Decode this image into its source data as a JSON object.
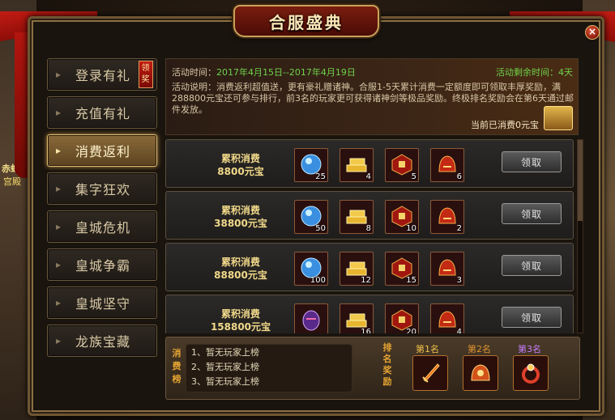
{
  "window": {
    "title": "合服盛典",
    "close_label": "×"
  },
  "background": {
    "left_text_1": "赤蛇",
    "left_text_2": "宫殿"
  },
  "sidebar": {
    "items": [
      {
        "label": "登录有礼",
        "badge": "领奖",
        "active": false
      },
      {
        "label": "充值有礼",
        "active": false
      },
      {
        "label": "消费返利",
        "active": true
      },
      {
        "label": "集字狂欢",
        "active": false
      },
      {
        "label": "皇城危机",
        "active": false
      },
      {
        "label": "皇城争霸",
        "active": false
      },
      {
        "label": "皇城坚守",
        "active": false
      },
      {
        "label": "龙族宝藏",
        "active": false
      }
    ]
  },
  "info": {
    "time_label": "活动时间：",
    "time_value": "2017年4月15日--2017年4月19日",
    "remain_label": "活动剩余时间：",
    "remain_value": "4天",
    "desc": "活动说明：消费返利超值送，更有豪礼赠诸神。合服1-5天累计消费一定额度即可领取丰厚奖励，满288800元宝还可参与排行，前3名的玩家更可获得诸神剑等极品奖励。终极排名奖励会在第6天通过邮件发放。",
    "current_label": "当前已消费",
    "current_value": "0元宝"
  },
  "rewards": {
    "claim_label": "领取",
    "rows": [
      {
        "title": "累积消费",
        "amount": "8800元宝",
        "counts": [
          "25",
          "4",
          "5",
          "6"
        ]
      },
      {
        "title": "累积消费",
        "amount": "38800元宝",
        "counts": [
          "50",
          "8",
          "10",
          "2"
        ]
      },
      {
        "title": "累积消费",
        "amount": "88800元宝",
        "counts": [
          "100",
          "12",
          "15",
          "3"
        ]
      },
      {
        "title": "累积消费",
        "amount": "158800元宝",
        "counts": [
          "",
          "16",
          "20",
          "4"
        ]
      }
    ],
    "item_icons": [
      "blue-orb-icon",
      "gold-bars-icon",
      "red-box-icon",
      "red-helmet-icon"
    ]
  },
  "ranking": {
    "left_label": "消费榜",
    "entries": [
      "1、暂无玩家上榜",
      "2、暂无玩家上榜",
      "3、暂无玩家上榜"
    ],
    "right_label": "排名奖励",
    "places": [
      {
        "label": "第1名",
        "color": "#f2c14a",
        "icon": "sword-icon"
      },
      {
        "label": "第2名",
        "color": "#e0932f",
        "icon": "dragon-helmet-icon"
      },
      {
        "label": "第3名",
        "color": "#c77dff",
        "icon": "ring-icon"
      }
    ]
  }
}
